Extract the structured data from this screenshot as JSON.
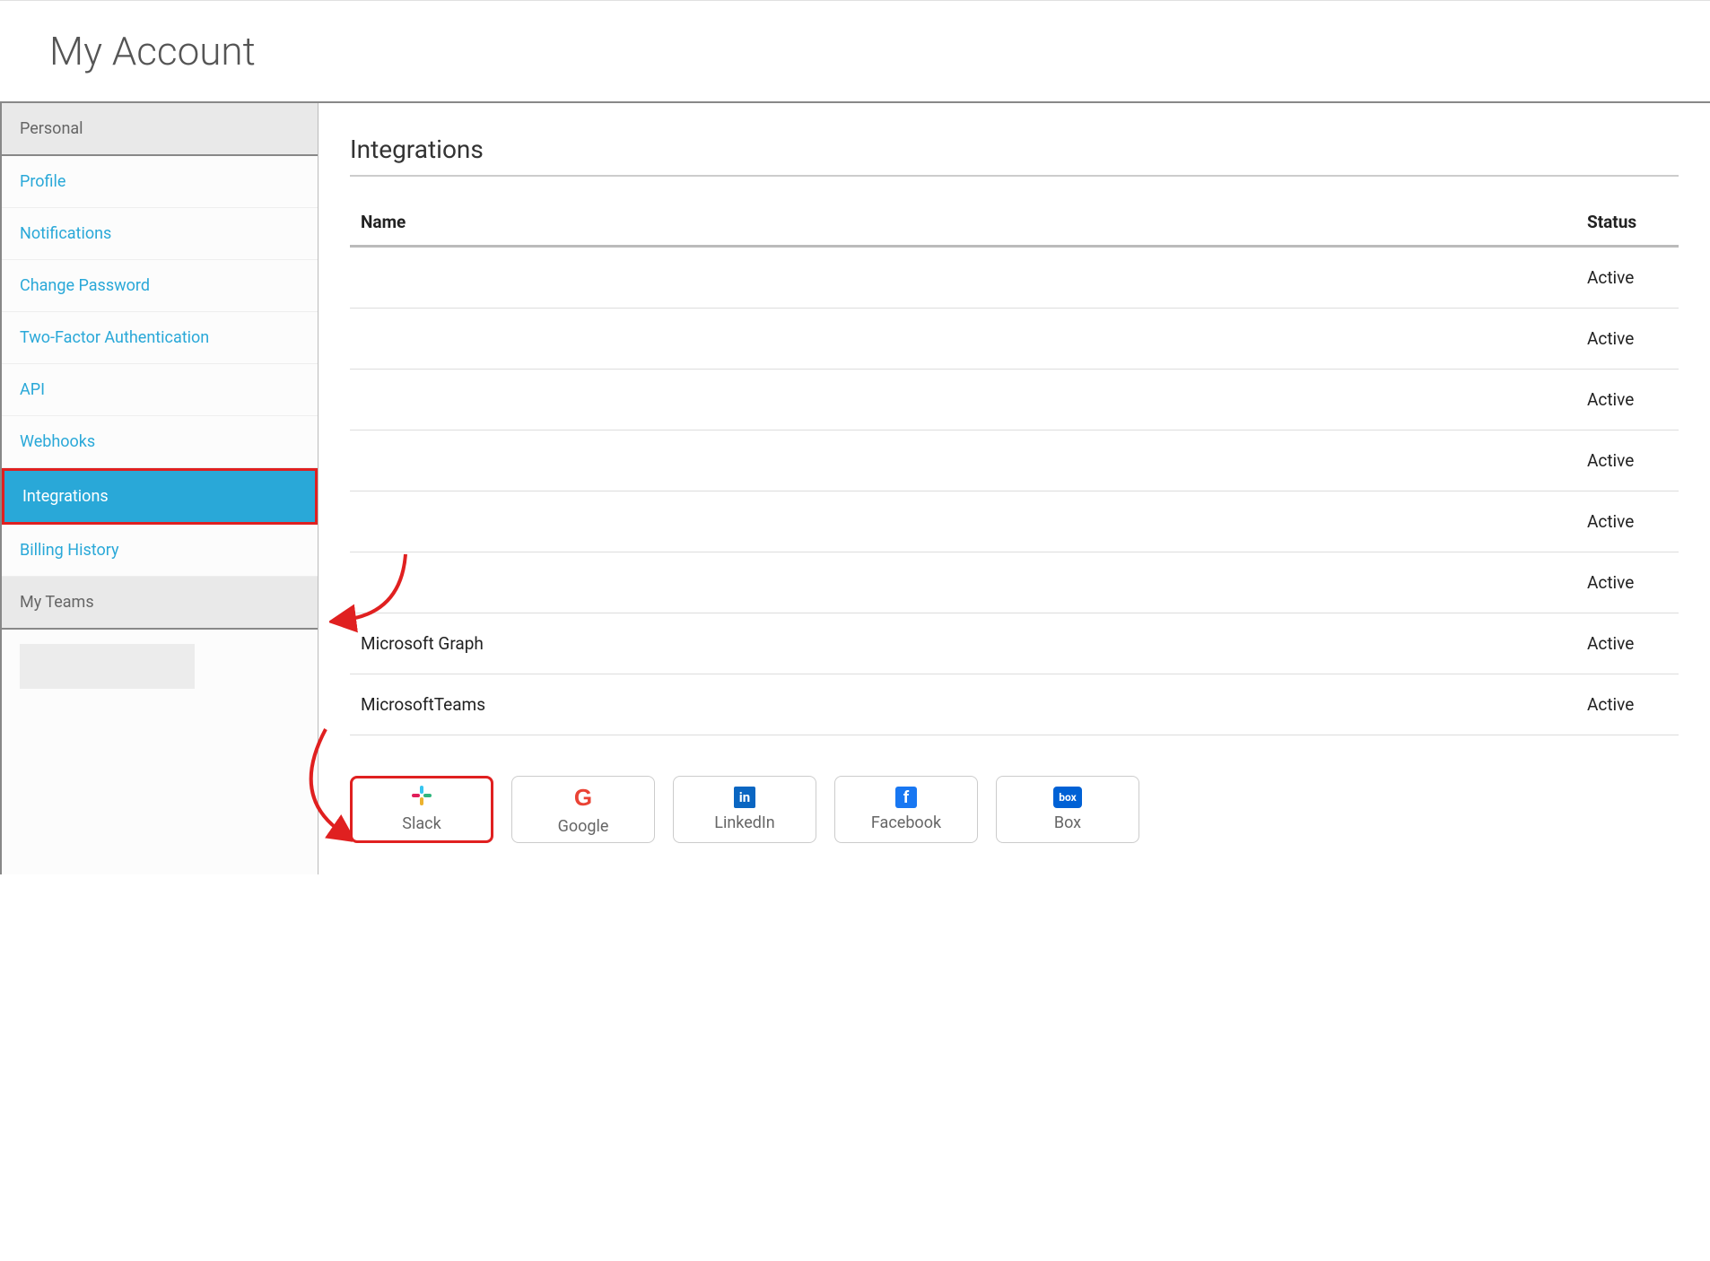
{
  "header": {
    "title": "My Account"
  },
  "sidebar": {
    "sections": [
      {
        "label": "Personal",
        "items": [
          {
            "label": "Profile",
            "active": false
          },
          {
            "label": "Notifications",
            "active": false
          },
          {
            "label": "Change Password",
            "active": false
          },
          {
            "label": "Two-Factor Authentication",
            "active": false
          },
          {
            "label": "API",
            "active": false
          },
          {
            "label": "Webhooks",
            "active": false
          },
          {
            "label": "Integrations",
            "active": true
          },
          {
            "label": "Billing History",
            "active": false
          }
        ]
      },
      {
        "label": "My Teams",
        "items": []
      }
    ]
  },
  "main": {
    "title": "Integrations",
    "table": {
      "columns": {
        "name": "Name",
        "status": "Status"
      },
      "rows": [
        {
          "name": "",
          "status": "Active"
        },
        {
          "name": "",
          "status": "Active"
        },
        {
          "name": "",
          "status": "Active"
        },
        {
          "name": "",
          "status": "Active"
        },
        {
          "name": "",
          "status": "Active"
        },
        {
          "name": "",
          "status": "Active"
        },
        {
          "name": "Microsoft Graph",
          "status": "Active"
        },
        {
          "name": "MicrosoftTeams",
          "status": "Active"
        }
      ]
    },
    "providers": [
      {
        "label": "Slack",
        "icon": "slack-icon",
        "highlighted": true
      },
      {
        "label": "Google",
        "icon": "google-icon",
        "highlighted": false
      },
      {
        "label": "LinkedIn",
        "icon": "linkedin-icon",
        "highlighted": false
      },
      {
        "label": "Facebook",
        "icon": "facebook-icon",
        "highlighted": false
      },
      {
        "label": "Box",
        "icon": "box-icon",
        "highlighted": false
      }
    ]
  },
  "annotations": {
    "arrow_to_integrations": true,
    "arrow_to_slack": true
  }
}
